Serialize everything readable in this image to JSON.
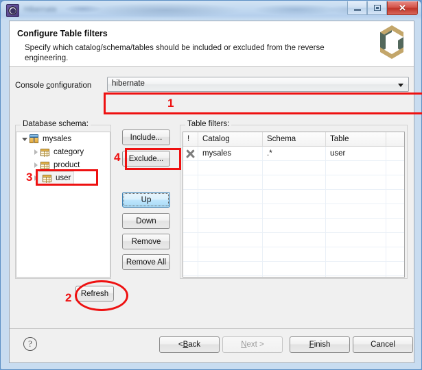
{
  "window": {
    "title": "Hibernate",
    "icon": "app-gear-icon",
    "buttons": {
      "minimize": "minimize-icon",
      "maximize": "maximize-icon",
      "close": "✕"
    }
  },
  "header": {
    "title": "Configure Table filters",
    "description": "Specify which catalog/schema/tables should be included or excluded from the reverse engineering.",
    "logo": "hibernate-logo"
  },
  "console": {
    "label_prefix": "Console ",
    "label_underlined": "c",
    "label_suffix": "onfiguration",
    "selected_value": "hibernate",
    "options": [
      "hibernate"
    ],
    "arrow": "chevron-down-icon"
  },
  "schema_panel": {
    "group_label": "Database schema:",
    "tree": [
      {
        "label": "mysales",
        "level": 0,
        "expanded": true,
        "icon": "database-icon",
        "selected": false
      },
      {
        "label": "category",
        "level": 1,
        "expanded": false,
        "icon": "table-icon",
        "selected": false
      },
      {
        "label": "product",
        "level": 1,
        "expanded": false,
        "icon": "table-icon",
        "selected": false
      },
      {
        "label": "user",
        "level": 1,
        "expanded": false,
        "icon": "table-icon",
        "selected": true
      }
    ],
    "refresh_label": "Refresh"
  },
  "actions": {
    "include": "Include...",
    "exclude": "Exclude...",
    "up": "Up",
    "down": "Down",
    "remove": "Remove",
    "remove_all": "Remove All"
  },
  "filters_panel": {
    "group_label": "Table filters:",
    "columns": [
      "!",
      "Catalog",
      "Schema",
      "Table",
      ""
    ],
    "rows": [
      {
        "flag": "exclude-x-icon",
        "catalog": "mysales",
        "schema": ".*",
        "table": "user"
      }
    ]
  },
  "footer": {
    "help": "?",
    "back_prefix": "< ",
    "back_underlined": "B",
    "back_suffix": "ack",
    "next_prefix": "",
    "next_underlined": "N",
    "next_suffix": "ext >",
    "next_disabled": true,
    "finish_underlined": "F",
    "finish_suffix": "inish",
    "cancel": "Cancel"
  },
  "annotations": {
    "accent_color": "#ee1111",
    "markers": [
      {
        "number": "1",
        "target": "console-configuration-combo",
        "shape": "box"
      },
      {
        "number": "2",
        "target": "refresh-button",
        "shape": "ellipse"
      },
      {
        "number": "3",
        "target": "tree-item-user",
        "shape": "box"
      },
      {
        "number": "4",
        "target": "exclude-button",
        "shape": "box"
      }
    ]
  }
}
